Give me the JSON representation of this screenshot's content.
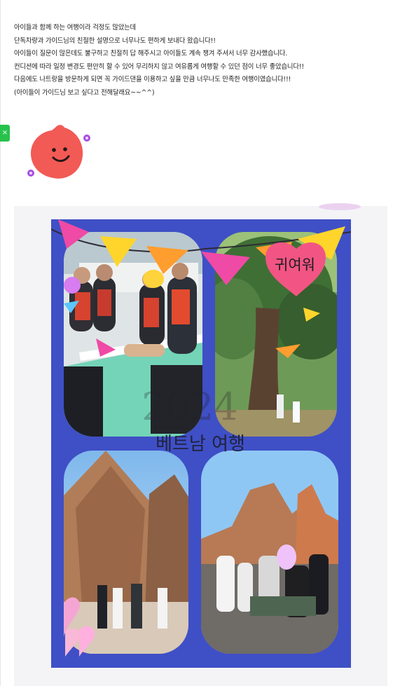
{
  "review": {
    "lines": [
      "아이들과 함께 하는 여행이라 걱정도 많았는데",
      "단독차량과 가이드님의 친절한 설명으로 너무나도 편하게 보내다 왔습니다!!",
      "아이들이 질문이 많은데도 불구하고 친절히 답 해주시고 아이들도 계속 챙겨 주셔서 너무 감사했습니다.",
      "컨디션에 따라 일정 변경도 편안히 할 수 있어 무리하지 않고 여유롭게 여행할 수 있던 점이 너무 좋았습니다!!",
      "다음에도 나트랑을 방문하게 되면 꼭 가이드댄을 이용하고 싶을 만큼 너무나도 만족한 여행이였습니다!!!",
      "(아이들이 가이드님 보고 싶다고 전해달래요~~^^)"
    ]
  },
  "side_tab": {
    "label": "×"
  },
  "collage": {
    "heart_text": "귀여워",
    "year_text": "2024",
    "caption": "베트남 여행"
  },
  "colors": {
    "collage_bg": "#3f4fc6",
    "side_tab": "#27c24c",
    "sticker": "#f25a55",
    "heart": "#f25583"
  },
  "icons": {
    "sticker": "smiling-blob-sticker-icon",
    "side_tab": "close-icon"
  }
}
